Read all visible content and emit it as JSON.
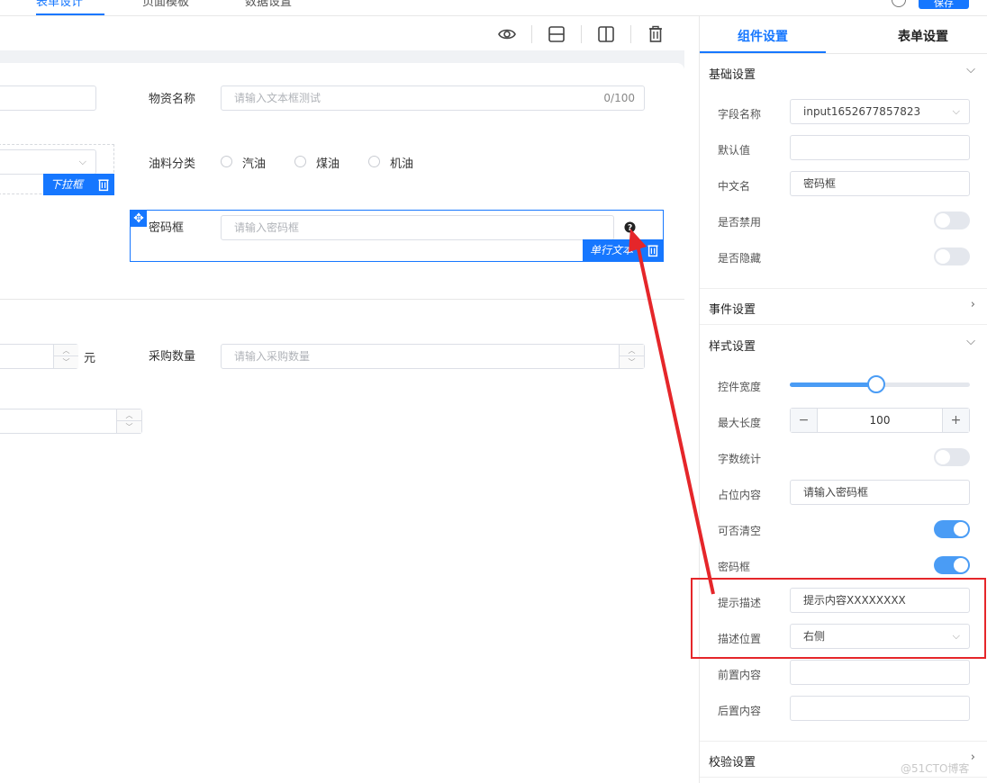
{
  "topbar": {
    "tabs": [
      {
        "label": "表单设计",
        "active": true
      },
      {
        "label": "页面模板",
        "active": false
      },
      {
        "label": "数据设置",
        "active": false
      }
    ],
    "save_label": "保存"
  },
  "toolbar": {
    "icons": [
      "eye-icon",
      "row-layout-icon",
      "column-layout-icon",
      "trash-icon"
    ]
  },
  "form": {
    "material_name_label": "物资名称",
    "material_name_placeholder": "请输入文本框测试",
    "material_name_counter": "0/100",
    "dropdown_tag": "下拉框",
    "fuel_type_label": "油料分类",
    "fuel_options": [
      "汽油",
      "煤油",
      "机油"
    ],
    "password_label": "密码框",
    "password_placeholder": "请输入密码框",
    "single_line_tag": "单行文本",
    "unit_yuan": "元",
    "purchase_qty_label": "采购数量",
    "purchase_qty_placeholder": "请输入采购数量"
  },
  "panel": {
    "tabs": [
      {
        "label": "组件设置",
        "active": true
      },
      {
        "label": "表单设置",
        "active": false
      }
    ],
    "basic": {
      "title": "基础设置",
      "field_name_label": "字段名称",
      "field_name_value": "input1652677857823",
      "default_label": "默认值",
      "default_value": "",
      "cn_name_label": "中文名",
      "cn_name_value": "密码框",
      "disabled_label": "是否禁用",
      "disabled": false,
      "hidden_label": "是否隐藏",
      "hidden": false
    },
    "events": {
      "title": "事件设置"
    },
    "style": {
      "title": "样式设置",
      "width_label": "控件宽度",
      "width_fraction": 0.48,
      "maxlen_label": "最大长度",
      "maxlen_value": "100",
      "count_label": "字数统计",
      "count_on": false,
      "placeholder_label": "占位内容",
      "placeholder_value": "请输入密码框",
      "clearable_label": "可否清空",
      "clearable_on": true,
      "password_label": "密码框",
      "password_on": true,
      "tip_label": "提示描述",
      "tip_value": "提示内容XXXXXXXX",
      "tip_pos_label": "描述位置",
      "tip_pos_value": "右侧",
      "prefix_label": "前置内容",
      "prefix_value": "",
      "suffix_label": "后置内容",
      "suffix_value": ""
    },
    "validation": {
      "title": "校验设置"
    }
  },
  "colors": {
    "accent": "#1677ff",
    "annotation": "#e5262a",
    "switch_on": "#4a9cf5"
  },
  "watermark": "@51CTO博客"
}
